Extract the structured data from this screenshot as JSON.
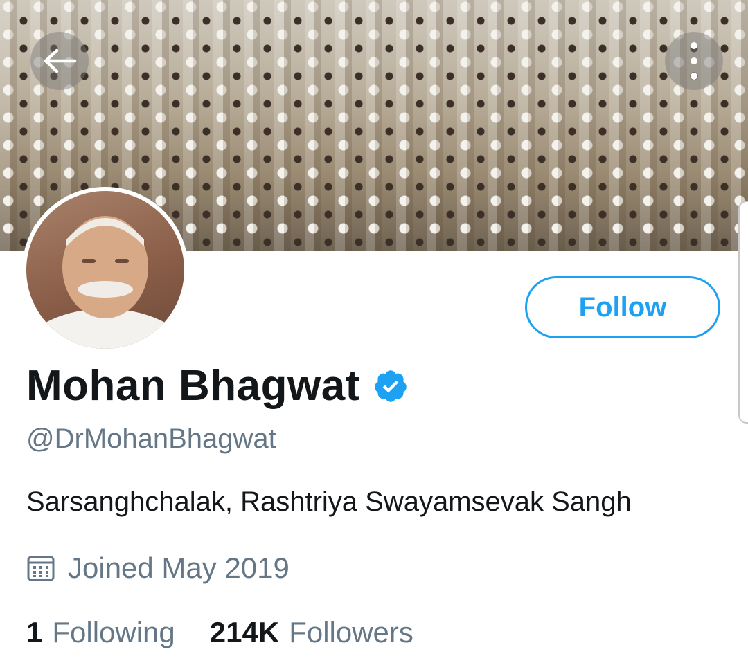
{
  "profile": {
    "name": "Mohan Bhagwat",
    "handle": "@DrMohanBhagwat",
    "bio": "Sarsanghchalak, Rashtriya Swayamsevak Sangh",
    "joined": "Joined May 2019",
    "verified": true
  },
  "actions": {
    "follow_label": "Follow"
  },
  "stats": {
    "following_count": "1",
    "following_label": "Following",
    "followers_count": "214K",
    "followers_label": "Followers"
  },
  "icons": {
    "back": "arrow-left-icon",
    "more": "more-vertical-icon",
    "verified": "verified-badge-icon",
    "calendar": "calendar-icon"
  },
  "colors": {
    "accent": "#1da1f2",
    "text_primary": "#14171a",
    "text_secondary": "#657786"
  }
}
